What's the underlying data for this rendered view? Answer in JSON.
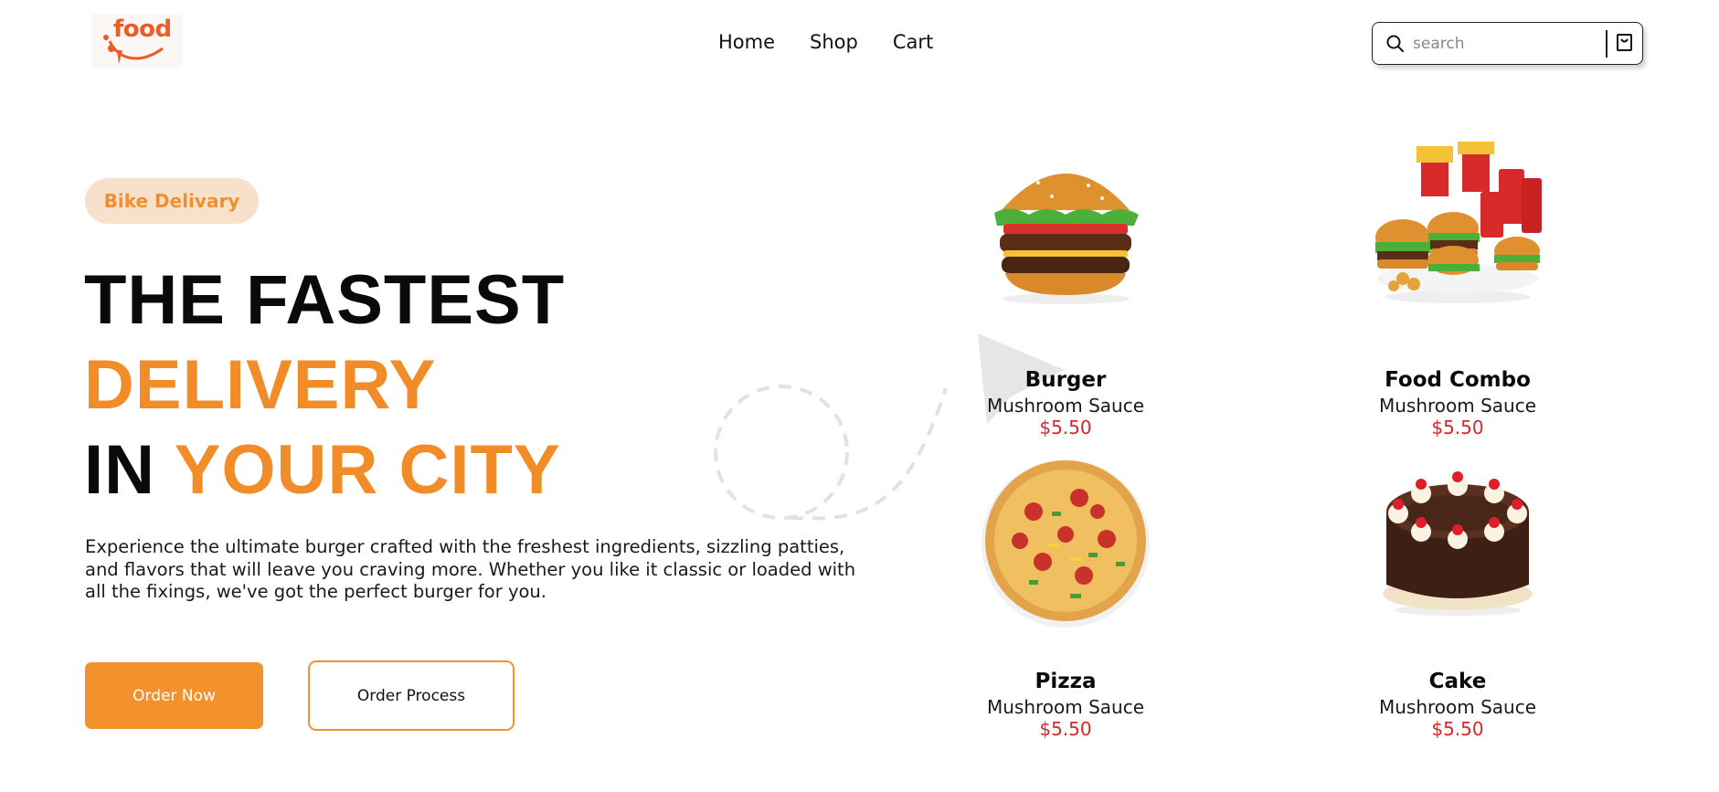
{
  "logo": {
    "text": "food"
  },
  "nav": {
    "items": [
      {
        "label": "Home"
      },
      {
        "label": "Shop"
      },
      {
        "label": "Cart"
      }
    ]
  },
  "search": {
    "placeholder": "search",
    "value": ""
  },
  "hero": {
    "badge": "Bike Delivary",
    "line1": "THE FASTEST",
    "line2": "DELIVERY",
    "line3_black": "IN",
    "line3_orange": "YOUR CITY",
    "description": "Experience the ultimate burger crafted with the freshest ingredients, sizzling patties, and flavors that will leave you craving more. Whether you like it classic or loaded with all the fixings, we've got the perfect burger for you.",
    "order_now": "Order Now",
    "order_process": "Order Process"
  },
  "products": [
    {
      "name": "Burger",
      "subtitle": "Mushroom Sauce",
      "price": "$5.50",
      "icon": "burger-image"
    },
    {
      "name": "Food Combo",
      "subtitle": "Mushroom Sauce",
      "price": "$5.50",
      "icon": "food-combo-image"
    },
    {
      "name": "Pizza",
      "subtitle": "Mushroom Sauce",
      "price": "$5.50",
      "icon": "pizza-image"
    },
    {
      "name": "Cake",
      "subtitle": "Mushroom Sauce",
      "price": "$5.50",
      "icon": "cake-image"
    }
  ],
  "colors": {
    "accent": "#f3912c",
    "price": "#d8262a",
    "badge_bg": "#f8e1cb",
    "logo": "#ef5b25"
  }
}
